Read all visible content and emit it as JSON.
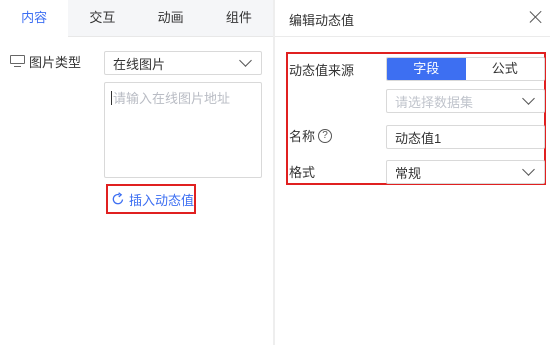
{
  "tabs": [
    {
      "label": "内容",
      "active": true
    },
    {
      "label": "交互",
      "active": false
    },
    {
      "label": "动画",
      "active": false
    },
    {
      "label": "组件",
      "active": false
    }
  ],
  "image_type": {
    "label": "图片类型",
    "icon": "monitor-icon",
    "selected": "在线图片"
  },
  "url_input": {
    "placeholder": "请输入在线图片地址"
  },
  "insert_button": {
    "label": "插入动态值",
    "icon": "refresh-icon"
  },
  "dialog": {
    "title": "编辑动态值",
    "close_icon": "close-icon",
    "source": {
      "label": "动态值来源",
      "options": [
        "字段",
        "公式"
      ],
      "selected": "字段"
    },
    "dataset": {
      "placeholder": "请选择数据集"
    },
    "name": {
      "label": "名称",
      "help_icon": "help-icon",
      "value": "动态值1"
    },
    "format": {
      "label": "格式",
      "selected": "常规"
    }
  },
  "colors": {
    "accent": "#3d6ff2",
    "highlight": "#e02020"
  }
}
